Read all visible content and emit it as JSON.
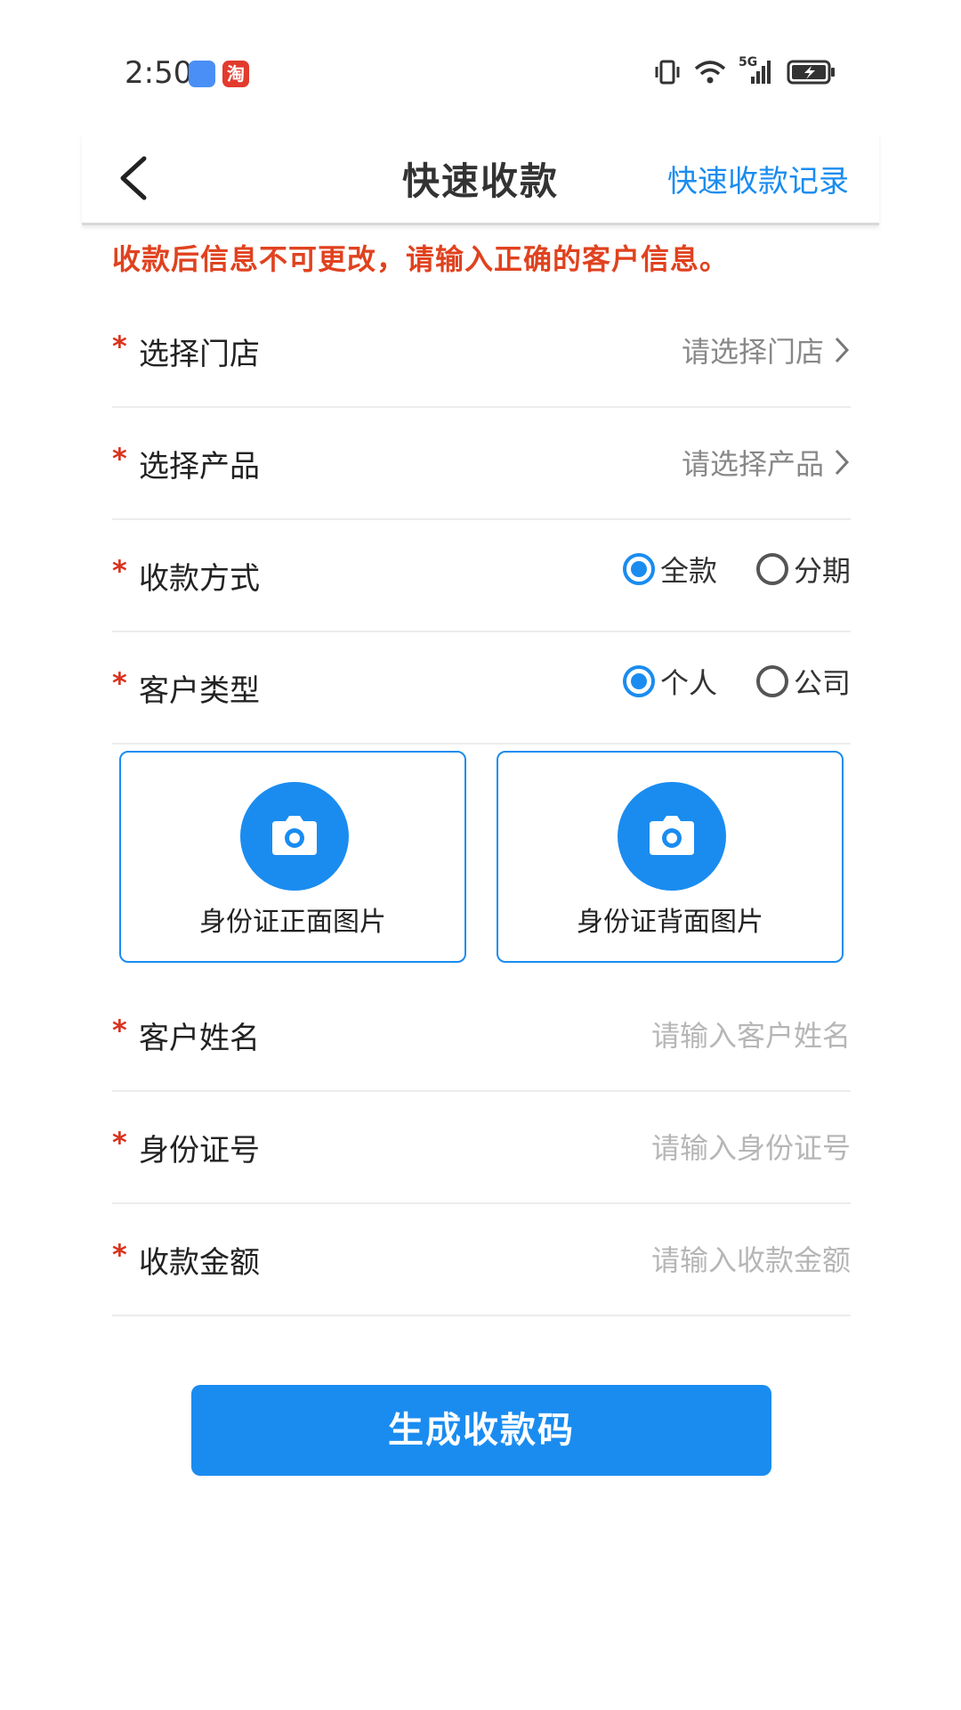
{
  "status_bar": {
    "time": "2:50",
    "network_label": "5G",
    "icons": [
      "usb-icon",
      "taobao-app-icon",
      "vibrate-icon",
      "wifi-icon",
      "signal-icon",
      "battery-icon"
    ]
  },
  "header": {
    "title": "快速收款",
    "record_link": "快速收款记录"
  },
  "warning": "收款后信息不可更改，请输入正确的客户信息。",
  "form": {
    "required_mark": "*",
    "store": {
      "label": "选择门店",
      "value": "请选择门店"
    },
    "product": {
      "label": "选择产品",
      "value": "请选择产品"
    },
    "payment_method": {
      "label": "收款方式",
      "options": [
        "全款",
        "分期"
      ],
      "selected": "全款"
    },
    "customer_type": {
      "label": "客户类型",
      "options": [
        "个人",
        "公司"
      ],
      "selected": "个人"
    },
    "id_front": {
      "label": "身份证正面图片"
    },
    "id_back": {
      "label": "身份证背面图片"
    },
    "customer_name": {
      "label": "客户姓名",
      "placeholder": "请输入客户姓名"
    },
    "id_number": {
      "label": "身份证号",
      "placeholder": "请输入身份证号"
    },
    "amount": {
      "label": "收款金额",
      "placeholder": "请输入收款金额"
    }
  },
  "submit_label": "生成收款码",
  "colors": {
    "accent": "#1a8cf0",
    "warning": "#e0421f",
    "required": "#d9331f"
  }
}
